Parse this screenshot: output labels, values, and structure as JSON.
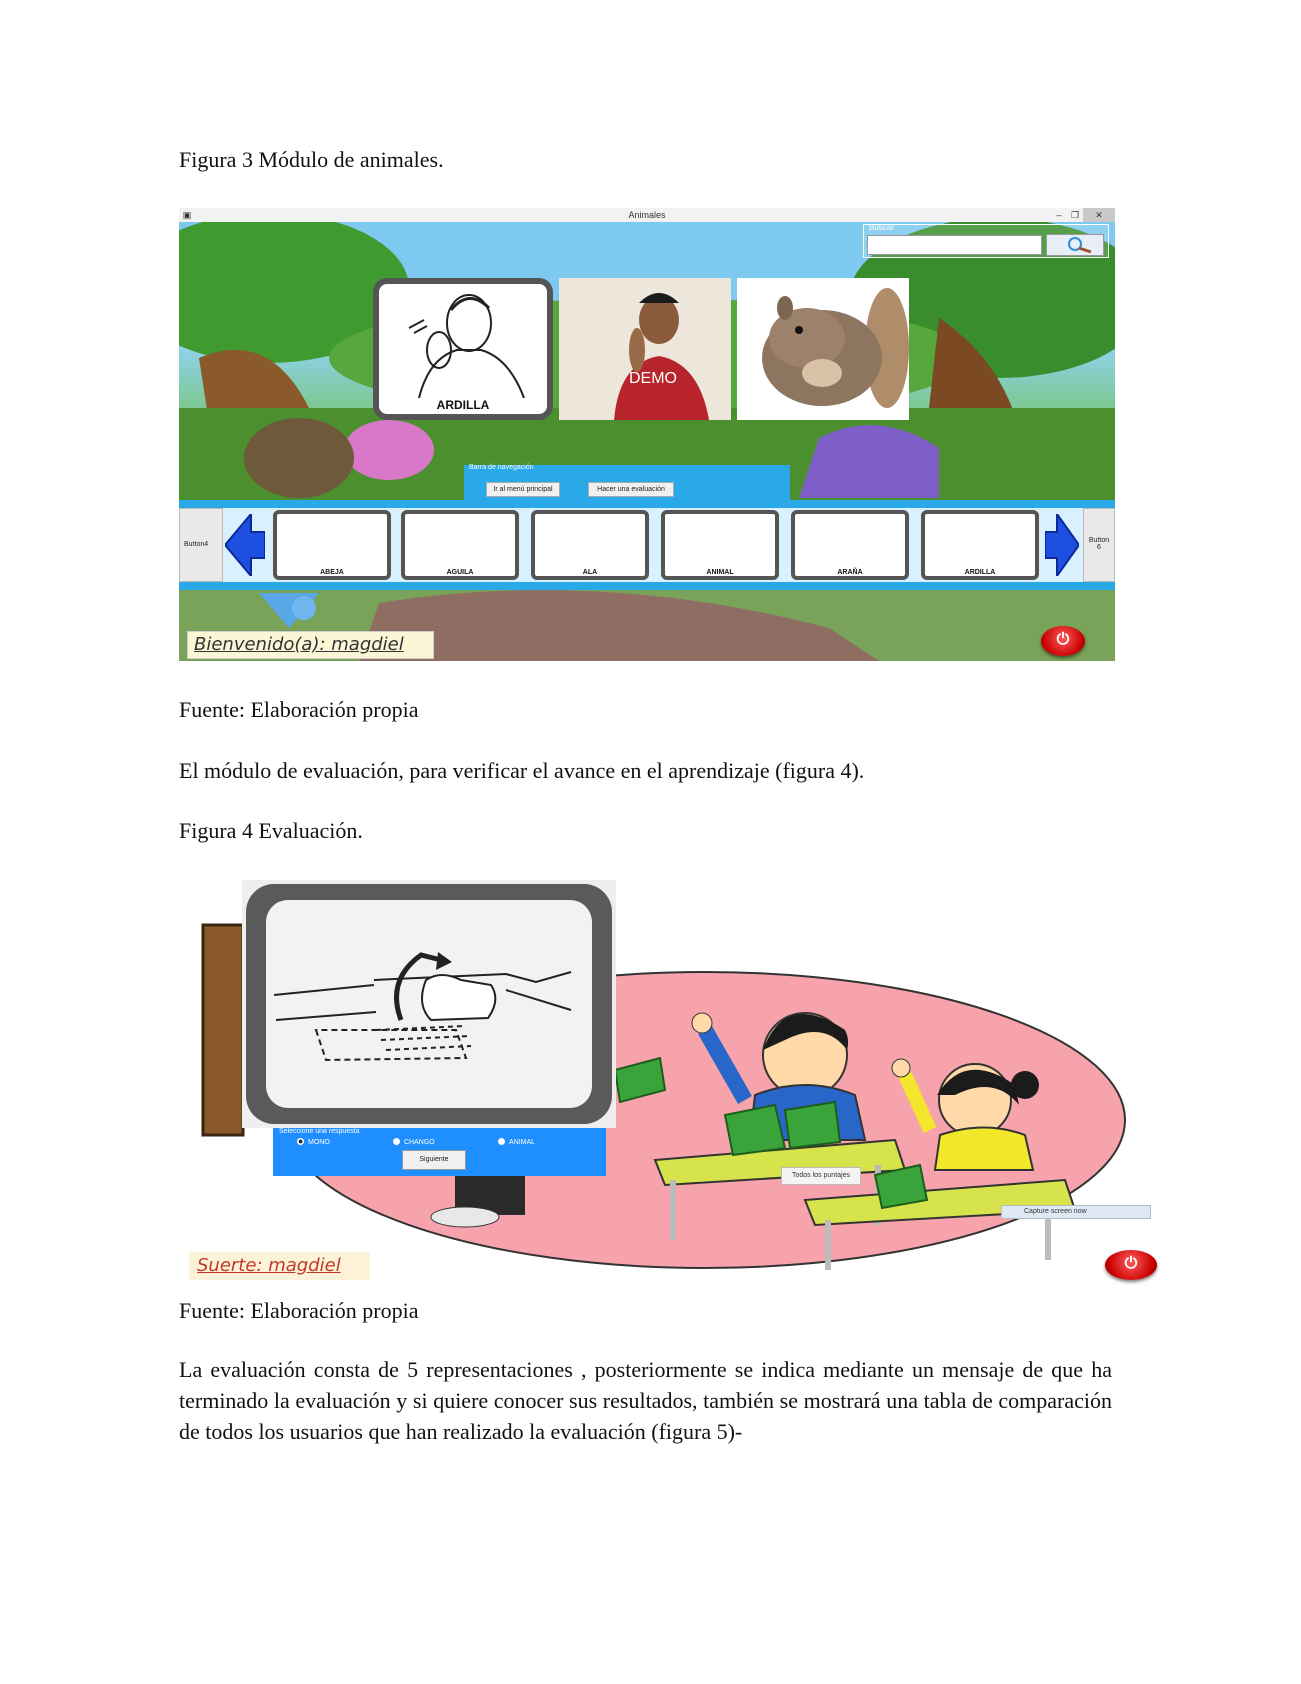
{
  "captions": {
    "fig3": "Figura 3 Módulo de animales.",
    "fig3_source": "Fuente: Elaboración propia",
    "intro_fig4": "El módulo de evaluación, para verificar el avance en el aprendizaje (figura 4).",
    "fig4": "Figura 4 Evaluación.",
    "fig4_source": "Fuente: Elaboración propia"
  },
  "body_paragraph": "La evaluación consta de 5 representaciones , posteriormente  se indica mediante un mensaje de que ha terminado la evaluación y si quiere conocer sus resultados, también se mostrará una tabla de comparación de todos los usuarios que han realizado la evaluación (figura 5)-",
  "animales_window": {
    "title": "Animales",
    "search_label": "Buscar",
    "main_sign_label": "ARDILLA",
    "video_overlay": "DEMO",
    "nav_panel_label": "Barra de navegación",
    "nav_buttons": [
      "Ir al menú principal",
      "Hacer una evaluación"
    ],
    "left_button": "Button4",
    "right_button": "Button 6",
    "thumbnails": [
      "ABEJA",
      "AGUILA",
      "ALA",
      "ANIMAL",
      "ARAÑA",
      "ARDILLA"
    ],
    "welcome": "Bienvenido(a): magdiel"
  },
  "evaluation_window": {
    "prompt": "Seleccione una respuesta",
    "options": [
      "MONO",
      "CHANGO",
      "ANIMAL"
    ],
    "selected_option": "MONO",
    "next_button": "Siguiente",
    "scores_button": "Todos los puntajes",
    "capture_button": "Capture screen now",
    "luck": "Suerte: magdiel"
  },
  "colors": {
    "panel_blue": "#29a9e8",
    "eval_blue": "#1f8fff",
    "power_red": "#c80000",
    "ellipse_pink": "#f7a3ab"
  }
}
